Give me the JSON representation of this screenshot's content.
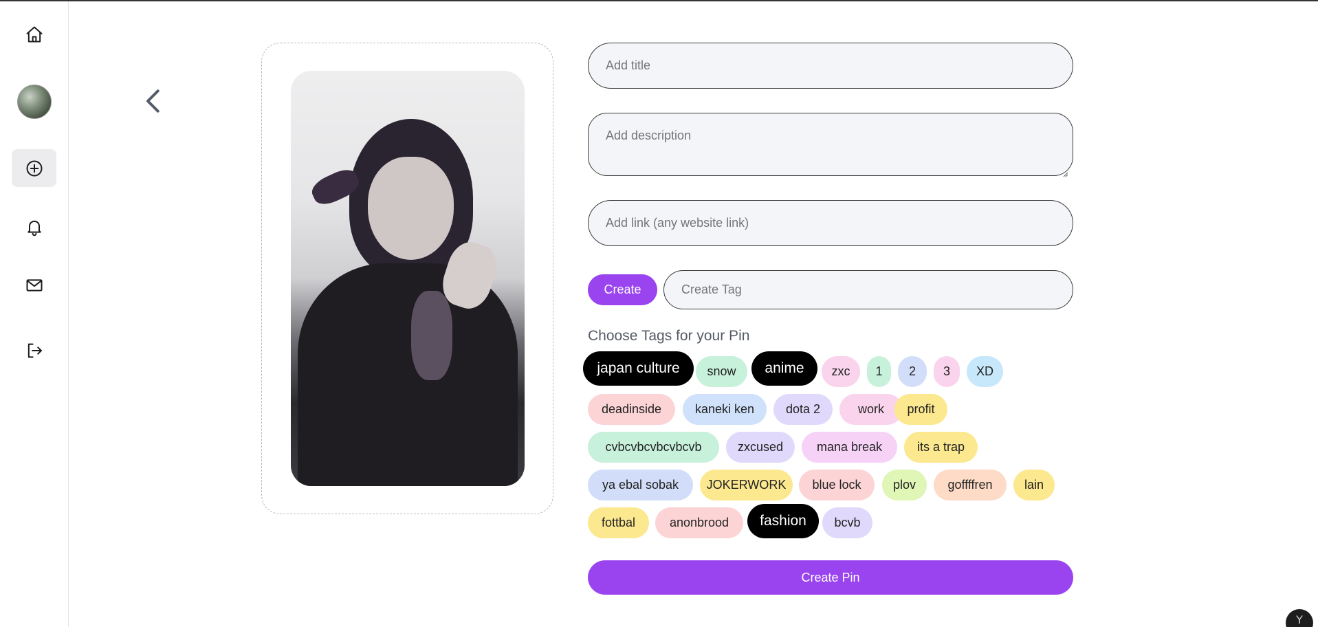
{
  "sidebar": {
    "items": [
      {
        "icon": "home-icon"
      },
      {
        "icon": "avatar"
      },
      {
        "icon": "plus-circle-icon",
        "active": true
      },
      {
        "icon": "bell-icon"
      },
      {
        "icon": "mail-icon"
      },
      {
        "icon": "logout-icon"
      }
    ]
  },
  "back": {
    "icon": "chevron-left-icon"
  },
  "form": {
    "title_placeholder": "Add title",
    "description_placeholder": "Add description",
    "link_placeholder": "Add link (any website link)",
    "create_button": "Create",
    "create_tag_placeholder": "Create Tag",
    "tags_heading": "Choose Tags for your Pin",
    "submit_button": "Create Pin"
  },
  "tags": [
    {
      "label": "japan culture",
      "color": "#000000",
      "selected": true
    },
    {
      "label": "snow",
      "color": "#c8f1dc"
    },
    {
      "label": "anime",
      "color": "#000000",
      "selected": true
    },
    {
      "label": "zxc",
      "color": "#f9d4ec"
    },
    {
      "label": "1",
      "color": "#c8f1dc"
    },
    {
      "label": "2",
      "color": "#d2def9"
    },
    {
      "label": "3",
      "color": "#f9d4ec"
    },
    {
      "label": "XD",
      "color": "#c7e7fb"
    },
    {
      "label": "deadinside",
      "color": "#fcd4d6"
    },
    {
      "label": "kaneki ken",
      "color": "#cfe1fb"
    },
    {
      "label": "dota 2",
      "color": "#e0d9fb"
    },
    {
      "label": "work",
      "color": "#f9d4ec"
    },
    {
      "label": "profit",
      "color": "#fce88f"
    },
    {
      "label": "cvbcvbcvbcvbcvb",
      "color": "#c8f1dc"
    },
    {
      "label": "zxcused",
      "color": "#e0d9fb"
    },
    {
      "label": "mana break",
      "color": "#f6d2f7"
    },
    {
      "label": "its a trap",
      "color": "#fce88f"
    },
    {
      "label": "ya ebal sobak",
      "color": "#d2def9"
    },
    {
      "label": "JOKERWORK",
      "color": "#fce88f"
    },
    {
      "label": "blue lock",
      "color": "#fcd4d6"
    },
    {
      "label": "plov",
      "color": "#dff6b6"
    },
    {
      "label": "goffffren",
      "color": "#fddbc6"
    },
    {
      "label": "lain",
      "color": "#fce88f"
    },
    {
      "label": "fottbal",
      "color": "#fce88f"
    },
    {
      "label": "anonbrood",
      "color": "#fcd4d6"
    },
    {
      "label": "fashion",
      "color": "#000000",
      "selected": true
    },
    {
      "label": "bcvb",
      "color": "#e0d9fb"
    }
  ],
  "corner_badge": "Y"
}
